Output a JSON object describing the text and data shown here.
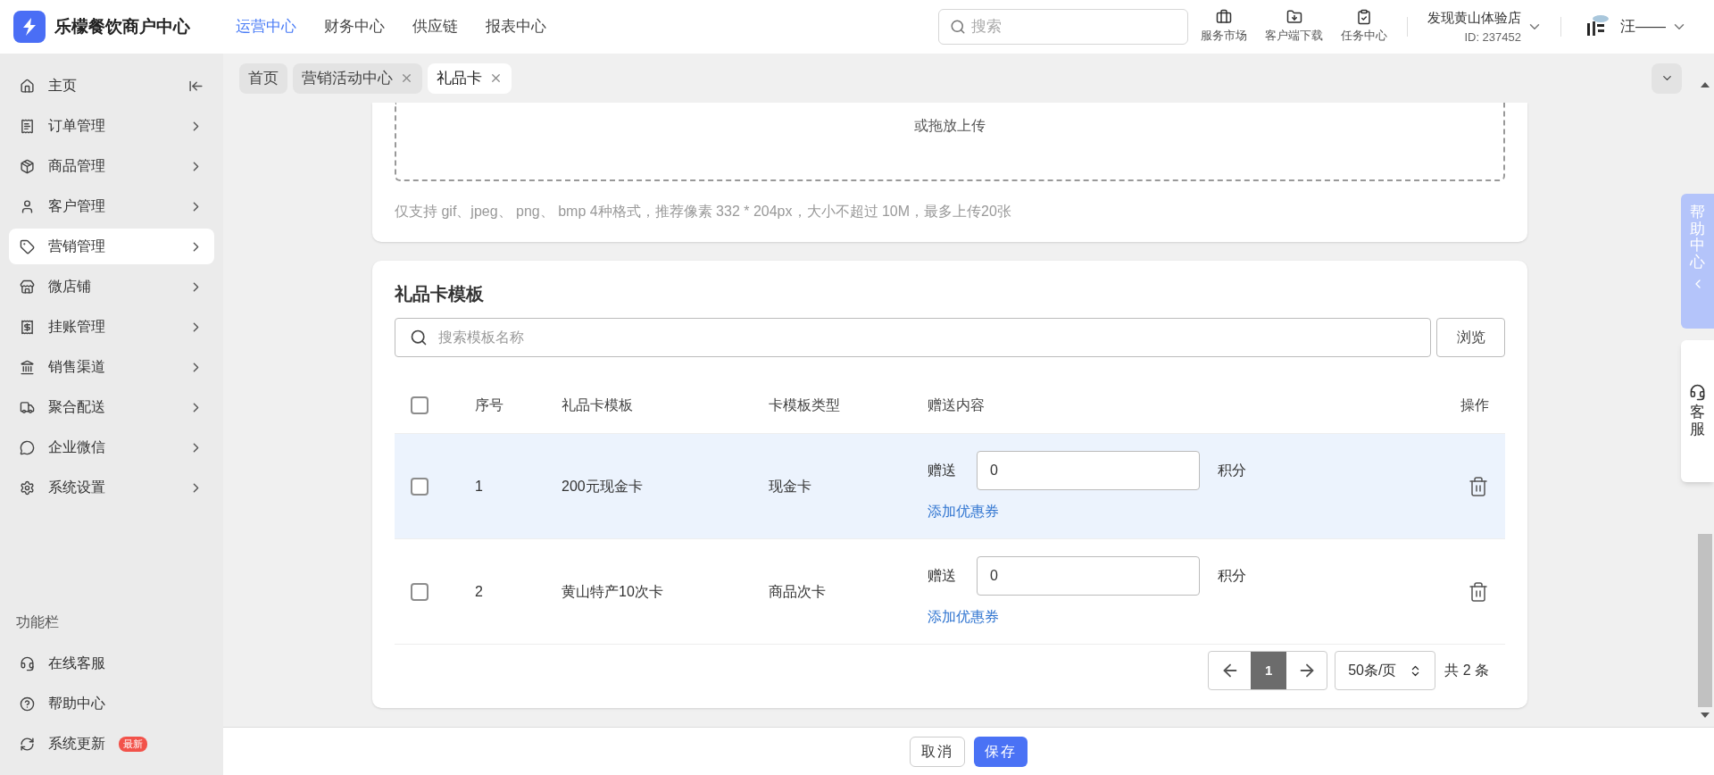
{
  "brand": {
    "name": "乐檬餐饮商户中心"
  },
  "top_nav": [
    {
      "label": "运营中心",
      "selected": true
    },
    {
      "label": "财务中心",
      "selected": false
    },
    {
      "label": "供应链",
      "selected": false
    },
    {
      "label": "报表中心",
      "selected": false
    }
  ],
  "search": {
    "placeholder": "搜索"
  },
  "shortcuts": [
    {
      "kind": "market",
      "label": "服务市场"
    },
    {
      "kind": "download",
      "label": "客户端下载"
    },
    {
      "kind": "tasks",
      "label": "任务中心"
    }
  ],
  "store": {
    "name": "发现黄山体验店",
    "id": "ID: 237452"
  },
  "user": {
    "name": "汪——"
  },
  "sidebar": {
    "items": [
      {
        "kind": "home",
        "label": "主页",
        "selected": false
      },
      {
        "kind": "orders",
        "label": "订单管理",
        "selected": false
      },
      {
        "kind": "goods",
        "label": "商品管理",
        "selected": false
      },
      {
        "kind": "customer",
        "label": "客户管理",
        "selected": false
      },
      {
        "kind": "marketing",
        "label": "营销管理",
        "selected": true
      },
      {
        "kind": "shop",
        "label": "微店铺",
        "selected": false
      },
      {
        "kind": "credit",
        "label": "挂账管理",
        "selected": false
      },
      {
        "kind": "channel",
        "label": "销售渠道",
        "selected": false
      },
      {
        "kind": "delivery",
        "label": "聚合配送",
        "selected": false
      },
      {
        "kind": "wechat",
        "label": "企业微信",
        "selected": false
      },
      {
        "kind": "settings",
        "label": "系统设置",
        "selected": false
      }
    ],
    "section_title": "功能栏",
    "tools": [
      {
        "kind": "service",
        "label": "在线客服"
      },
      {
        "kind": "help",
        "label": "帮助中心"
      },
      {
        "kind": "update",
        "label": "系统更新",
        "badge": "最新"
      }
    ]
  },
  "page_tabs": [
    {
      "label": "首页",
      "selected": false,
      "closable": false
    },
    {
      "label": "营销活动中心",
      "selected": false,
      "closable": true
    },
    {
      "label": "礼品卡",
      "selected": true,
      "closable": true
    }
  ],
  "upload": {
    "drop_text": "或拖放上传",
    "hint": "仅支持 gif、jpeg、 png、 bmp 4种格式，推荐像素 332 * 204px，大小不超过 10M，最多上传20张"
  },
  "templates": {
    "title": "礼品卡模板",
    "search_placeholder": "搜索模板名称",
    "browse_button": "浏览",
    "columns": [
      "序号",
      "礼品卡模板",
      "卡模板类型",
      "赠送内容",
      "操作"
    ],
    "header_checked": false,
    "rows": [
      {
        "index": "1",
        "name": "200元现金卡",
        "type": "现金卡",
        "give_label": "赠送",
        "points": "0",
        "unit": "积分",
        "coupon_link": "添加优惠券",
        "checked": false,
        "highlighted": true
      },
      {
        "index": "2",
        "name": "黄山特产10次卡",
        "type": "商品次卡",
        "give_label": "赠送",
        "points": "0",
        "unit": "积分",
        "coupon_link": "添加优惠券",
        "checked": false,
        "highlighted": false
      }
    ],
    "pagination": {
      "pages": [
        {
          "label": "1",
          "selected": true
        }
      ],
      "page_size": "50条/页",
      "total": "共 2 条"
    }
  },
  "footer": {
    "cancel": "取消",
    "save": "保存"
  },
  "float": {
    "help": "帮助中心",
    "service": "客服"
  }
}
